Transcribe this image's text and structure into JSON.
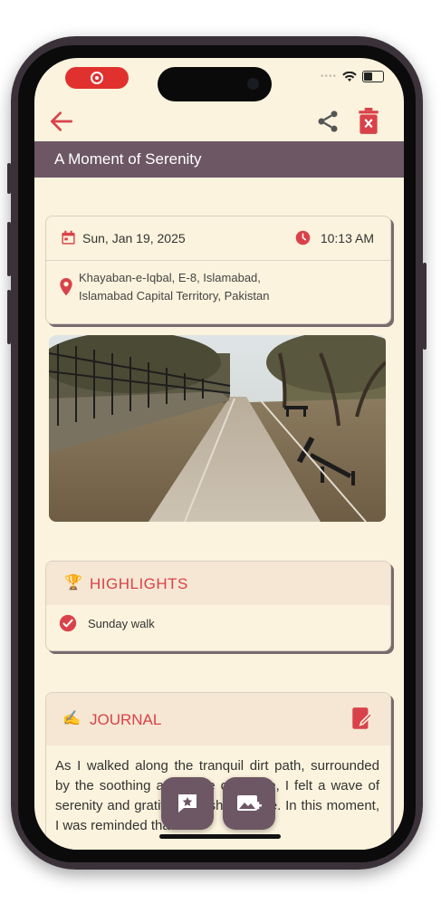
{
  "toolbar": {
    "back": "back",
    "share": "share",
    "delete": "delete"
  },
  "entry": {
    "title": "A Moment of Serenity",
    "date": "Sun, Jan 19, 2025",
    "time": "10:13 AM",
    "address_line1": "Khayaban-e-Iqbal, E-8, Islamabad,",
    "address_line2": "Islamabad Capital Territory, Pakistan"
  },
  "highlights": {
    "emoji": "🏆",
    "title": "HIGHLIGHTS",
    "items": [
      "Sunday walk"
    ]
  },
  "journal": {
    "emoji": "✍️",
    "title": "JOURNAL",
    "text": "As I walked along the tranquil dirt path, surrounded by the soothing ambiance of nature, I felt a wave of serenity and gratitude wash over me. In this moment, I was reminded that"
  },
  "icons": {
    "back": "arrow-left-icon",
    "share": "share-icon",
    "delete": "trash-icon",
    "calendar": "calendar-icon",
    "clock": "clock-icon",
    "location": "location-pin-icon",
    "check": "check-circle-icon",
    "edit": "edit-note-icon",
    "add_note": "star-message-icon",
    "add_photo": "add-photo-icon"
  },
  "colors": {
    "accent": "#d9424a",
    "header": "#6d5764",
    "background": "#fbf3dd"
  }
}
